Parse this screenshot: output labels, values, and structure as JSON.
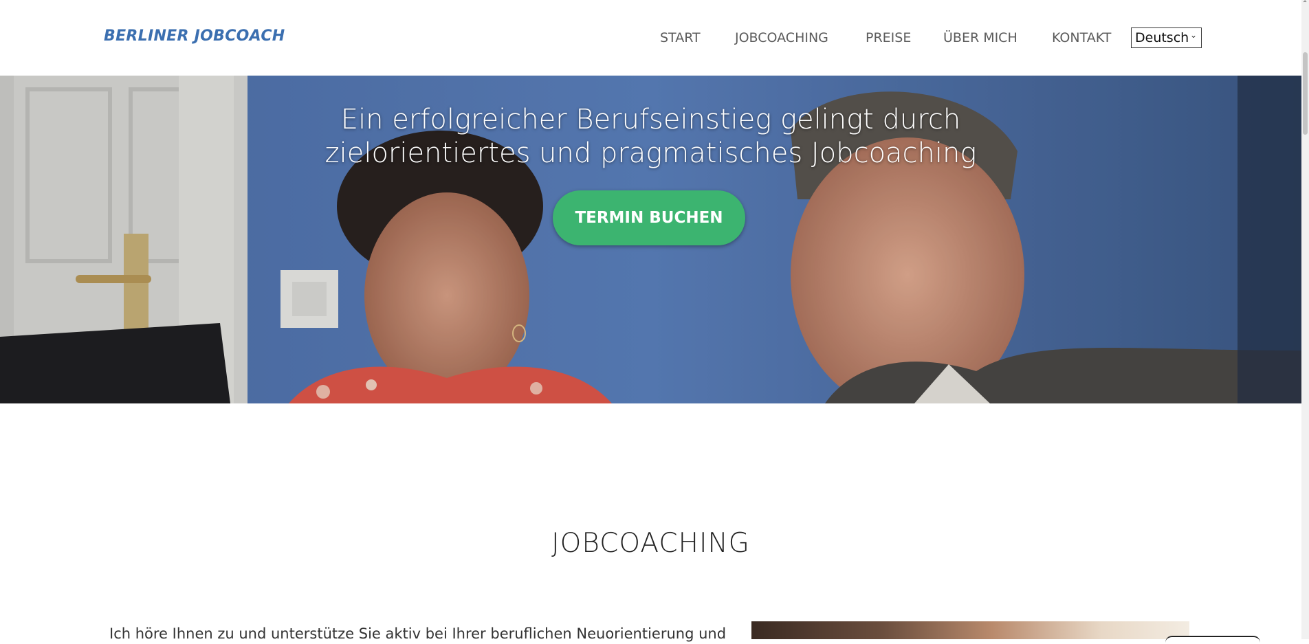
{
  "brand": {
    "logo_text": "BERLINER JOBCOACH",
    "color": "#3b6fb0"
  },
  "nav": {
    "items": [
      {
        "label": "START"
      },
      {
        "label": "JOBCOACHING"
      },
      {
        "label": "PREISE"
      },
      {
        "label": "ÜBER MICH"
      },
      {
        "label": "KONTAKT"
      }
    ],
    "language": {
      "selected": "Deutsch"
    }
  },
  "hero": {
    "title_line1": "Ein erfolgreicher Berufseinstieg gelingt durch",
    "title_line2": "zielorientiertes und pragmatisches Jobcoaching",
    "cta_label": "TERMIN BUCHEN",
    "cta_color": "#3cb470"
  },
  "section": {
    "title": "JOBCOACHING",
    "intro_text": "Ich höre Ihnen zu und unterstütze Sie aktiv bei Ihrer beruflichen Neuorientierung und"
  }
}
